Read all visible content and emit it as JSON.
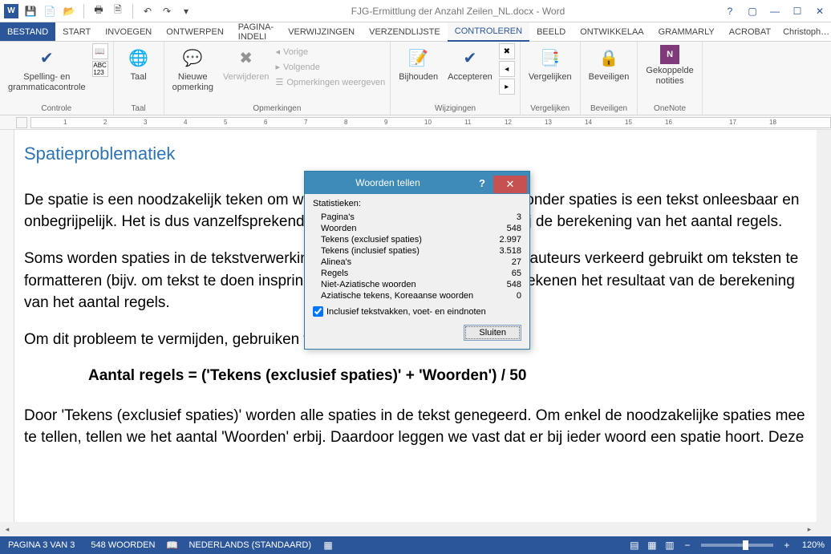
{
  "window": {
    "title": "FJG-Ermittlung der Anzahl Zeilen_NL.docx - Word",
    "user": "Christoph…"
  },
  "tabs": {
    "file": "BESTAND",
    "list": [
      "START",
      "INVOEGEN",
      "ONTWERPEN",
      "PAGINA-INDELI",
      "VERWIJZINGEN",
      "VERZENDLIJSTE",
      "CONTROLEREN",
      "BEELD",
      "ONTWIKKELAA",
      "GRAMMARLY",
      "ACROBAT"
    ],
    "active_index": 6
  },
  "ribbon": {
    "controle_group": "Controle",
    "spelling": "Spelling- en\ngrammaticacontrole",
    "taal": "Taal",
    "opmerkingen_group": "Opmerkingen",
    "nieuwe": "Nieuwe\nopmerking",
    "verwijderen": "Verwijderen",
    "vorige": "Vorige",
    "volgende": "Volgende",
    "weergeven": "Opmerkingen weergeven",
    "wijzigingen_group": "Wijzigingen",
    "bijhouden": "Bijhouden",
    "accepteren": "Accepteren",
    "vergelijken_group": "Vergelijken",
    "vergelijken": "Vergelijken",
    "beveiligen": "Beveiligen",
    "onenote_group": "OneNote",
    "onenote": "Gekoppelde\nnotities"
  },
  "document": {
    "heading": "Spatieproblematiek",
    "p1": "De spatie is een noodzakelijk teken om woorden van elkaar te scheiden. Zonder spaties is een tekst onleesbaar en onbegrijpelijk. Het is dus vanzelfsprekend dat spaties worden meegeteld bij de berekening van het aantal regels.",
    "p2": "Soms worden spaties in de tekstverwerking echter door minder geoefende auteurs verkeerd gebruikt om teksten te formatteren (bijv. om tekst te doen inspringen). Deze onnodige spaties vertekenen het resultaat van de berekening van het aantal regels.",
    "p3": "Om dit probleem te vermijden, gebruiken we bij PTS de volgende formule:",
    "formula": "Aantal regels = ('Tekens (exclusief spaties)' + 'Woorden') / 50",
    "p4": "Door 'Tekens (exclusief spaties)' worden alle spaties in de tekst genegeerd. Om enkel de noodzakelijke spaties mee te tellen, tellen we het aantal 'Woorden' erbij. Daardoor leggen we vast dat er bij ieder woord een spatie hoort. Deze"
  },
  "dialog": {
    "title": "Woorden tellen",
    "section": "Statistieken:",
    "stats": [
      {
        "label": "Pagina's",
        "value": "3"
      },
      {
        "label": "Woorden",
        "value": "548"
      },
      {
        "label": "Tekens (exclusief spaties)",
        "value": "2.997"
      },
      {
        "label": "Tekens (inclusief spaties)",
        "value": "3.518"
      },
      {
        "label": "Alinea's",
        "value": "27"
      },
      {
        "label": "Regels",
        "value": "65"
      },
      {
        "label": "Niet-Aziatische woorden",
        "value": "548"
      },
      {
        "label": "Aziatische tekens, Koreaanse woorden",
        "value": "0"
      }
    ],
    "checkbox_label": "Inclusief tekstvakken, voet- en eindnoten",
    "checkbox_checked": true,
    "close_btn": "Sluiten"
  },
  "statusbar": {
    "page": "PAGINA 3 VAN 3",
    "words": "548 WOORDEN",
    "spell": "",
    "lang": "NEDERLANDS (STANDAARD)",
    "zoom": "120%"
  },
  "ruler": {
    "nums": [
      "1",
      "2",
      "3",
      "4",
      "5",
      "6",
      "7",
      "8",
      "9",
      "10",
      "11",
      "12",
      "13",
      "14",
      "15",
      "16",
      "17",
      "18"
    ]
  }
}
